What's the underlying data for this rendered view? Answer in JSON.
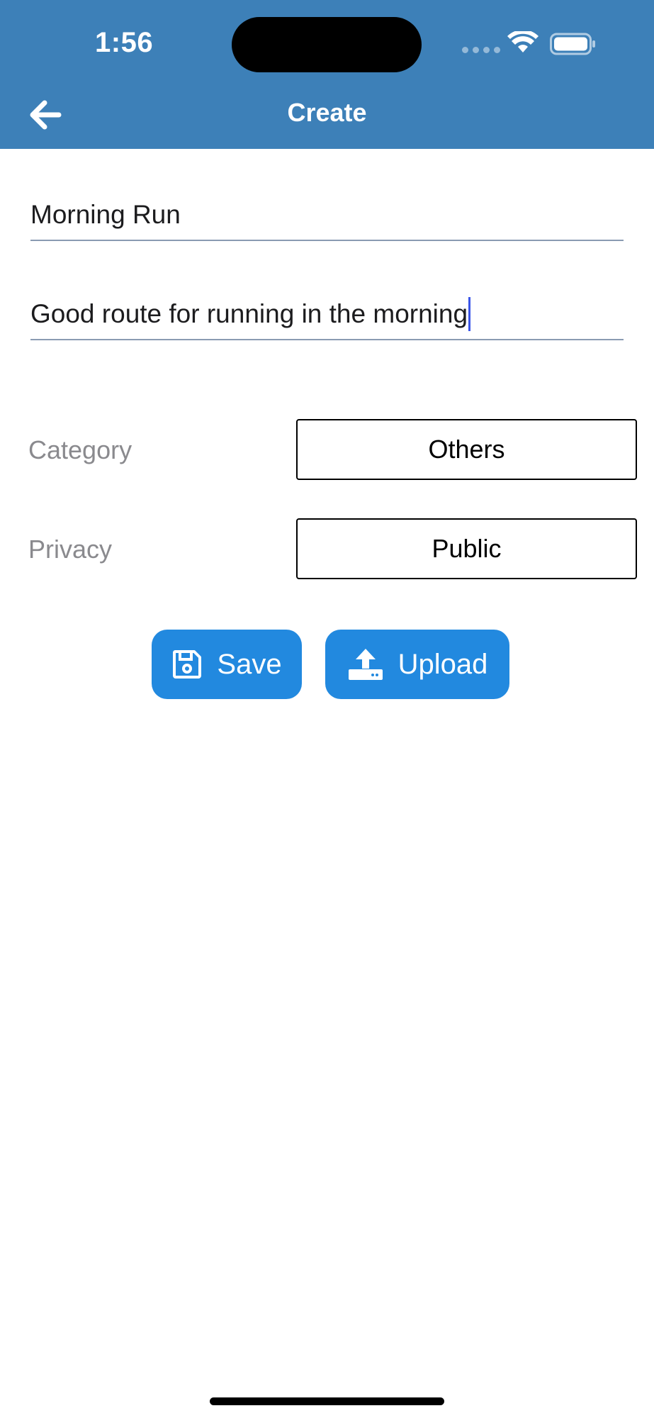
{
  "status_bar": {
    "time": "1:56",
    "icons": [
      "signal-icon",
      "wifi-icon",
      "battery-icon"
    ]
  },
  "header": {
    "title": "Create",
    "back_icon": "arrow-left-icon",
    "background_color": "#3d80b8"
  },
  "form": {
    "title_value": "Morning Run",
    "description_value": "Good route for running in the morning",
    "category": {
      "label": "Category",
      "selected": "Others"
    },
    "privacy": {
      "label": "Privacy",
      "selected": "Public"
    }
  },
  "actions": {
    "save": {
      "label": "Save",
      "icon": "floppy-disk-icon"
    },
    "upload": {
      "label": "Upload",
      "icon": "upload-icon"
    },
    "button_color": "#2289df"
  }
}
